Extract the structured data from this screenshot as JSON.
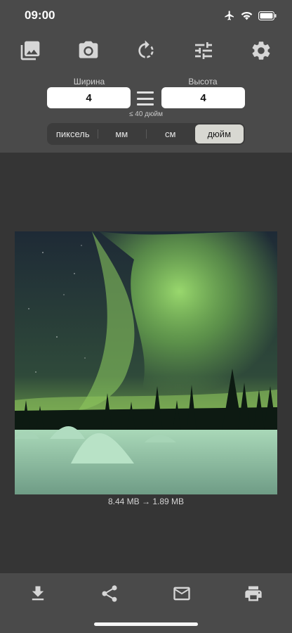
{
  "status_bar": {
    "time": "09:00",
    "icons": [
      "airplane-icon",
      "wifi-icon",
      "battery-icon"
    ]
  },
  "toolbar": {
    "buttons": [
      "gallery-icon",
      "camera-icon",
      "rotate-icon",
      "adjust-icon",
      "settings-icon"
    ]
  },
  "resize": {
    "width_label": "Ширина",
    "height_label": "Высота",
    "width_value": "4",
    "height_value": "4",
    "limit_note": "≤ 40 дюйм",
    "units": [
      "пиксель",
      "мм",
      "см",
      "дюйм"
    ],
    "active_unit": "дюйм"
  },
  "image": {
    "description_icon": "aurora-photo",
    "size_info": "8.44 MB  →  1.89 MB"
  },
  "bottom_bar": {
    "buttons": [
      "download-icon",
      "share-icon",
      "mail-icon",
      "print-icon"
    ]
  },
  "colors": {
    "panel": "#4a4a4a",
    "background": "#353535",
    "active_segment": "#d8d8d2"
  }
}
